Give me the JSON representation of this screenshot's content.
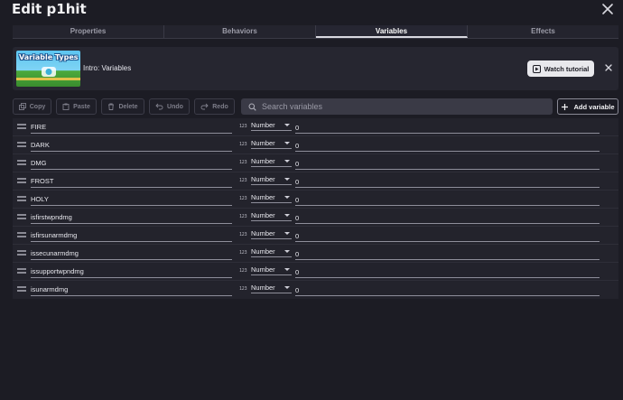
{
  "window": {
    "title": "Edit p1hit"
  },
  "tabs": [
    {
      "label": "Properties",
      "active": false
    },
    {
      "label": "Behaviors",
      "active": false
    },
    {
      "label": "Variables",
      "active": true
    },
    {
      "label": "Effects",
      "active": false
    }
  ],
  "tutorial": {
    "thumbnail_text": "Variable Types",
    "title": "Intro: Variables",
    "watch_label": "Watch tutorial"
  },
  "toolbar": {
    "copy_label": "Copy",
    "paste_label": "Paste",
    "delete_label": "Delete",
    "undo_label": "Undo",
    "redo_label": "Redo",
    "search_placeholder": "Search variables",
    "add_label": "Add variable"
  },
  "variables": [
    {
      "name": "FIRE",
      "type_icon": "123",
      "type": "Number",
      "value": "0"
    },
    {
      "name": "DARK",
      "type_icon": "123",
      "type": "Number",
      "value": "0"
    },
    {
      "name": "DMG",
      "type_icon": "123",
      "type": "Number",
      "value": "0"
    },
    {
      "name": "FROST",
      "type_icon": "123",
      "type": "Number",
      "value": "0"
    },
    {
      "name": "HOLY",
      "type_icon": "123",
      "type": "Number",
      "value": "0"
    },
    {
      "name": "isfirstwpndmg",
      "type_icon": "123",
      "type": "Number",
      "value": "0"
    },
    {
      "name": "isfirsunarmdmg",
      "type_icon": "123",
      "type": "Number",
      "value": "0"
    },
    {
      "name": "issecunarmdmg",
      "type_icon": "123",
      "type": "Number",
      "value": "0"
    },
    {
      "name": "issupportwpndmg",
      "type_icon": "123",
      "type": "Number",
      "value": "0"
    },
    {
      "name": "isunarmdmg",
      "type_icon": "123",
      "type": "Number",
      "value": "0"
    }
  ],
  "colors": {
    "background": "#1c1c24",
    "panel": "#262630",
    "accent_button": "#e8e8ec"
  }
}
